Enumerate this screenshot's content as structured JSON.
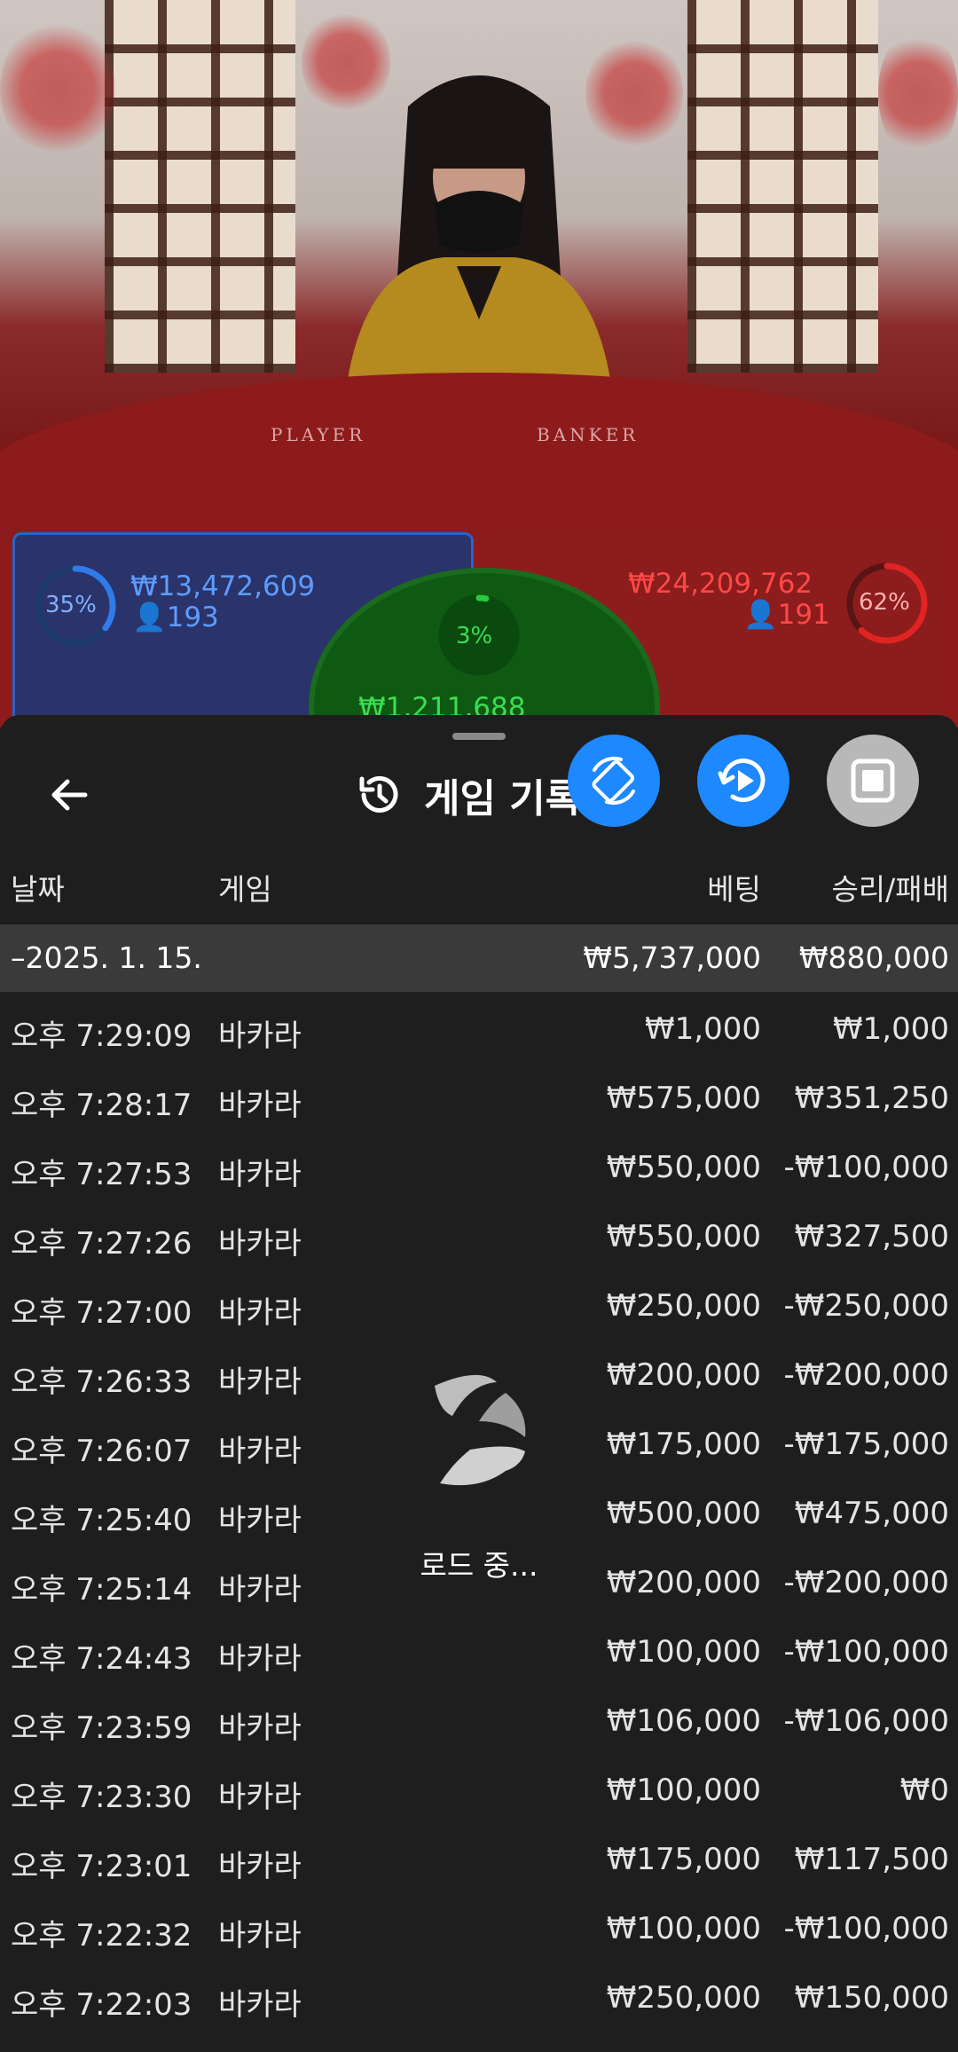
{
  "table": {
    "player_label": "PLAYER",
    "banker_label": "BANKER",
    "player": {
      "percent": "35%",
      "amount": "₩13,472,609",
      "players": "193",
      "ratio": 0.35,
      "color": "#2f7be8"
    },
    "tie": {
      "percent": "3%",
      "amount": "₩1,211,688",
      "ratio": 0.03,
      "color": "#27c93f"
    },
    "banker": {
      "percent": "62%",
      "amount": "₩24,209,762",
      "players": "191",
      "ratio": 0.62,
      "color": "#e02424"
    }
  },
  "sheet": {
    "title": "게임 기록",
    "columns": {
      "date": "날짜",
      "game": "게임",
      "bet": "베팅",
      "result": "승리/패배"
    },
    "group": {
      "date": "–2025. 1. 15.",
      "bet_total": "₩5,737,000",
      "result_total": "₩880,000"
    },
    "rows": [
      {
        "time": "오후 7:29:09",
        "game": "바카라",
        "bet": "₩1,000",
        "result": "₩1,000"
      },
      {
        "time": "오후 7:28:17",
        "game": "바카라",
        "bet": "₩575,000",
        "result": "₩351,250"
      },
      {
        "time": "오후 7:27:53",
        "game": "바카라",
        "bet": "₩550,000",
        "result": "-₩100,000"
      },
      {
        "time": "오후 7:27:26",
        "game": "바카라",
        "bet": "₩550,000",
        "result": "₩327,500"
      },
      {
        "time": "오후 7:27:00",
        "game": "바카라",
        "bet": "₩250,000",
        "result": "-₩250,000"
      },
      {
        "time": "오후 7:26:33",
        "game": "바카라",
        "bet": "₩200,000",
        "result": "-₩200,000"
      },
      {
        "time": "오후 7:26:07",
        "game": "바카라",
        "bet": "₩175,000",
        "result": "-₩175,000"
      },
      {
        "time": "오후 7:25:40",
        "game": "바카라",
        "bet": "₩500,000",
        "result": "₩475,000"
      },
      {
        "time": "오후 7:25:14",
        "game": "바카라",
        "bet": "₩200,000",
        "result": "-₩200,000"
      },
      {
        "time": "오후 7:24:43",
        "game": "바카라",
        "bet": "₩100,000",
        "result": "-₩100,000"
      },
      {
        "time": "오후 7:23:59",
        "game": "바카라",
        "bet": "₩106,000",
        "result": "-₩106,000"
      },
      {
        "time": "오후 7:23:30",
        "game": "바카라",
        "bet": "₩100,000",
        "result": "₩0"
      },
      {
        "time": "오후 7:23:01",
        "game": "바카라",
        "bet": "₩175,000",
        "result": "₩117,500"
      },
      {
        "time": "오후 7:22:32",
        "game": "바카라",
        "bet": "₩100,000",
        "result": "-₩100,000"
      },
      {
        "time": "오후 7:22:03",
        "game": "바카라",
        "bet": "₩250,000",
        "result": "₩150,000"
      }
    ],
    "loading_text": "로드 중..."
  },
  "icons": {
    "back": "arrow-left-icon",
    "history": "history-icon",
    "fab1": "rotate-device-icon",
    "fab2": "replay-icon",
    "fab3": "stop-icon"
  }
}
